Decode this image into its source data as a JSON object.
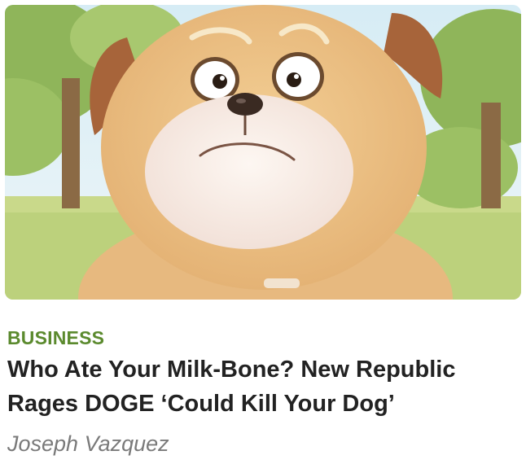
{
  "article": {
    "category": "BUSINESS",
    "headline": "Who Ate Your Milk-Bone? New Republic Rages DOGE ‘Could Kill Your Dog’",
    "author": "Joseph Vazquez",
    "thumbnail_icon": "cartoon-dog-illustration"
  },
  "colors": {
    "category": "#5b8a2e",
    "headline": "#222222",
    "author": "#7a7a7a"
  }
}
